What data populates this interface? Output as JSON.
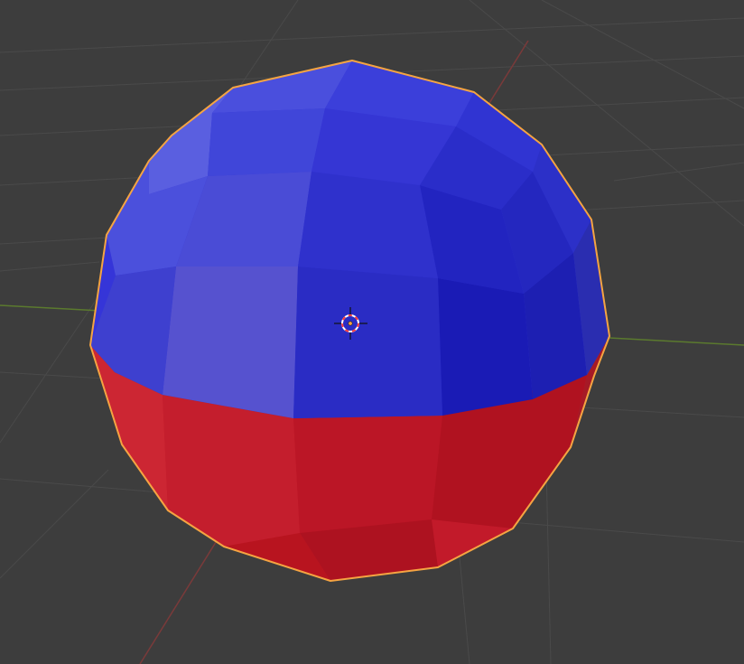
{
  "viewport": {
    "background_color": "#3d3d3d",
    "grid_color": "#4a4a4a",
    "x_axis_color": "#7a3a3a",
    "y_axis_color": "#5b7a2e"
  },
  "object": {
    "shape": "uv-sphere",
    "selected": true,
    "outline_color": "#f5a442",
    "top_material_color": "#3535d8",
    "bottom_material_color": "#c21a2a"
  },
  "cursor": {
    "icon": "3d-cursor-icon",
    "ring_color_a": "#ff3b3b",
    "ring_color_b": "#ffffff"
  },
  "origin": {
    "icon": "object-origin-icon",
    "color": "#f5a442"
  }
}
